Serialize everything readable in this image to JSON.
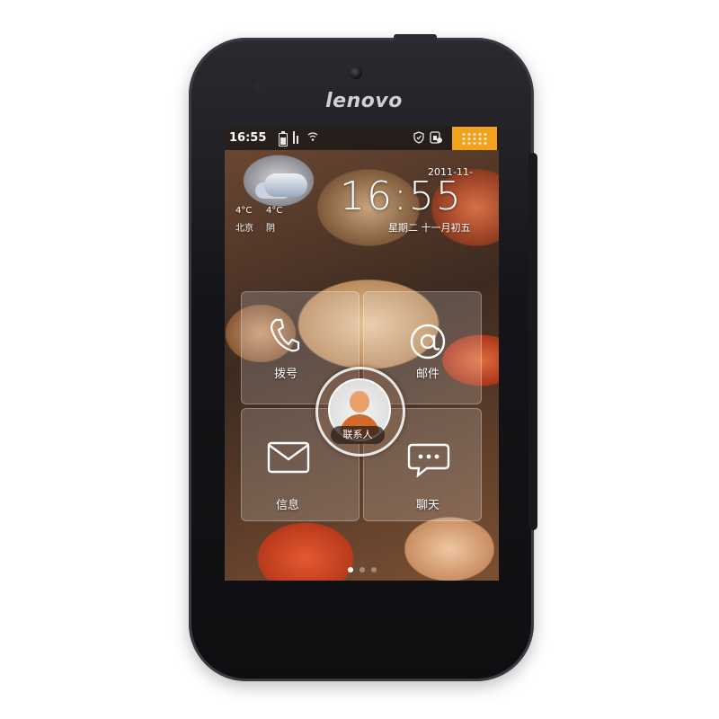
{
  "device": {
    "brand": "lenovo"
  },
  "status_bar": {
    "time": "16:55",
    "icons": [
      "battery-icon",
      "signal-icon",
      "wifi-icon",
      "shield-icon",
      "sim-icon"
    ],
    "accent_color": "#f3a21c"
  },
  "clock_widget": {
    "date": "2011-11-",
    "time": "16:55",
    "lunar": "星期二 十一月初五"
  },
  "weather": {
    "temp_low": "4°C",
    "temp_high": "4°C",
    "city": "北京",
    "condition": "阴"
  },
  "quick_grid": {
    "items": [
      {
        "label": "拨号",
        "icon": "phone-icon"
      },
      {
        "label": "邮件",
        "icon": "at-icon"
      },
      {
        "label": "信息",
        "icon": "envelope-icon"
      },
      {
        "label": "聊天",
        "icon": "chat-bubble-icon"
      }
    ],
    "center": {
      "label": "联系人",
      "icon": "contact-avatar-icon"
    }
  },
  "page_indicator": {
    "pages": 3,
    "active_index": 0
  }
}
